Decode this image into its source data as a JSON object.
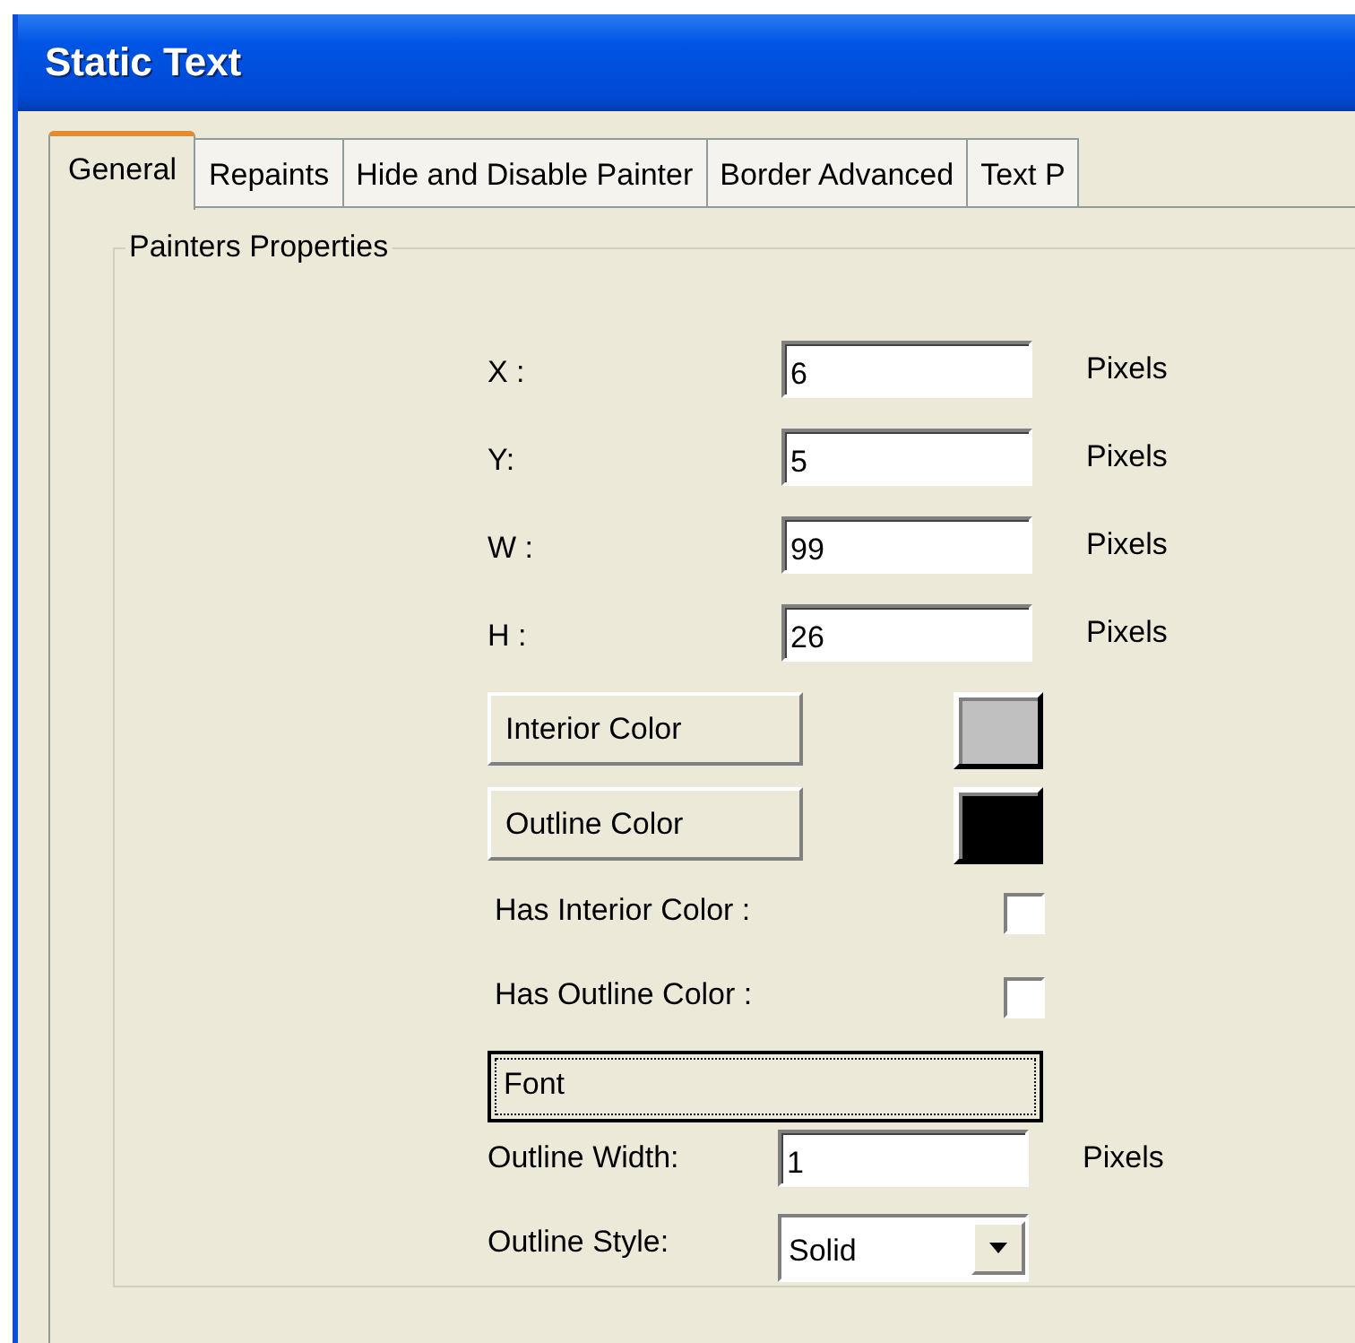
{
  "window": {
    "title": "Static Text"
  },
  "tabs": [
    {
      "label": "General",
      "selected": true
    },
    {
      "label": "Repaints",
      "selected": false
    },
    {
      "label": "Hide and Disable Painter",
      "selected": false
    },
    {
      "label": "Border Advanced",
      "selected": false
    },
    {
      "label": "Text P",
      "selected": false
    }
  ],
  "group": {
    "title": "Painters Properties"
  },
  "position_fields": [
    {
      "label": "X :",
      "value": "6",
      "unit": "Pixels"
    },
    {
      "label": "Y:",
      "value": "5",
      "unit": "Pixels"
    },
    {
      "label": "W :",
      "value": "99",
      "unit": "Pixels"
    },
    {
      "label": "H :",
      "value": "26",
      "unit": "Pixels"
    }
  ],
  "color_buttons": [
    {
      "label": "Interior Color",
      "color": "#c0c0c0"
    },
    {
      "label": "Outline Color",
      "color": "#000000"
    }
  ],
  "checkboxes": [
    {
      "label": "Has Interior Color :",
      "checked": false
    },
    {
      "label": "Has Outline Color :",
      "checked": false
    }
  ],
  "font_button": {
    "label": "Font",
    "focused": true
  },
  "outline_width": {
    "label": "Outline Width:",
    "value": "1",
    "unit": "Pixels"
  },
  "outline_style": {
    "label": "Outline Style:",
    "value": "Solid"
  }
}
